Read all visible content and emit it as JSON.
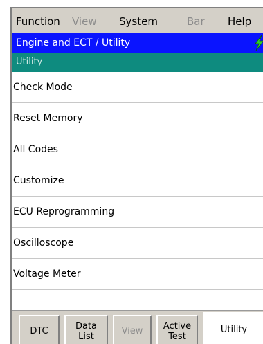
{
  "menubar": {
    "items": [
      {
        "label": "Function",
        "enabled": true
      },
      {
        "label": "View",
        "enabled": false
      },
      {
        "label": "System",
        "enabled": true
      },
      {
        "label": "Bar",
        "enabled": false
      },
      {
        "label": "Help",
        "enabled": true
      }
    ]
  },
  "header": {
    "title": "Engine and ECT / Utility",
    "title_bg_color": "#0a14ff",
    "status_icon": "lightning-bolt-icon",
    "status_icon_color": "#2ecc2e"
  },
  "subheader": {
    "label": "Utility",
    "bg_color": "#0e8b7f"
  },
  "menu_list": {
    "items": [
      "Check Mode",
      "Reset Memory",
      "All Codes",
      "Customize",
      "ECU Reprogramming",
      "Oscilloscope",
      "Voltage Meter"
    ]
  },
  "tabs": [
    {
      "label": "DTC",
      "enabled": true,
      "active": false
    },
    {
      "label": "Data\nList",
      "enabled": true,
      "active": false
    },
    {
      "label": "View",
      "enabled": false,
      "active": false
    },
    {
      "label": "Active\nTest",
      "enabled": true,
      "active": false
    },
    {
      "label": "Utility",
      "enabled": true,
      "active": true
    }
  ]
}
